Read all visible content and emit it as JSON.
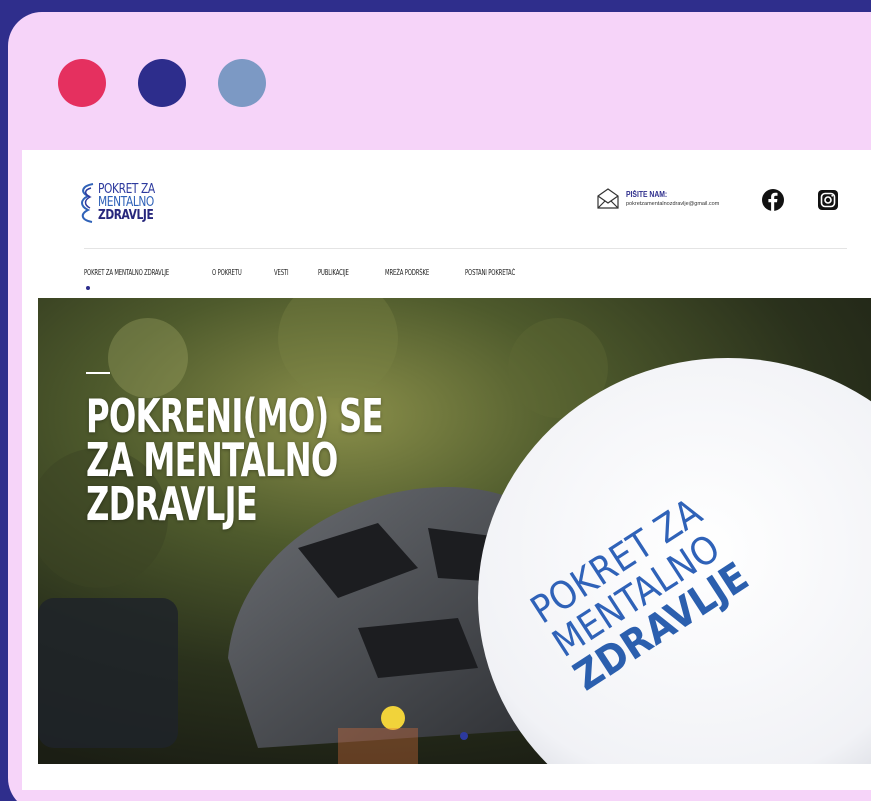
{
  "window": {
    "controls": [
      "close",
      "minimize",
      "maximize"
    ],
    "colors": {
      "frame": "#f6d4f9",
      "background": "#2f2e8c",
      "close": "#e5305f",
      "minimize": "#2d2d8c",
      "maximize": "#7c99c4"
    }
  },
  "header": {
    "logo": {
      "line1": "POKRET ZA",
      "line2": "MENTALNO",
      "line3": "ZDRAVLJE"
    },
    "contact": {
      "label": "PIŠITE NAM:",
      "email": "pokretzamentalnozdravlje@gmail.com",
      "icon": "envelope-icon"
    },
    "social": [
      {
        "name": "facebook",
        "icon": "facebook-icon"
      },
      {
        "name": "instagram",
        "icon": "instagram-icon"
      }
    ]
  },
  "nav": {
    "items": [
      {
        "label": "POKRET ZA MENTALNO ZDRAVLJE",
        "active": true
      },
      {
        "label": "O POKRETU"
      },
      {
        "label": "VESTI"
      },
      {
        "label": "PUBLIKACIJE"
      },
      {
        "label": "MREŽA PODRŠKE"
      },
      {
        "label": "POSTANI POKRETAČ"
      }
    ]
  },
  "hero": {
    "title_lines": [
      "POKRENI(MO) SE",
      "ZA MENTALNO",
      "ZDRAVLJE"
    ],
    "balloon_text": {
      "line1": "POKRET ZA",
      "line2": "MENTALNO",
      "line3": "ZDRAVLJE"
    },
    "accent": "#2d3a9e"
  }
}
